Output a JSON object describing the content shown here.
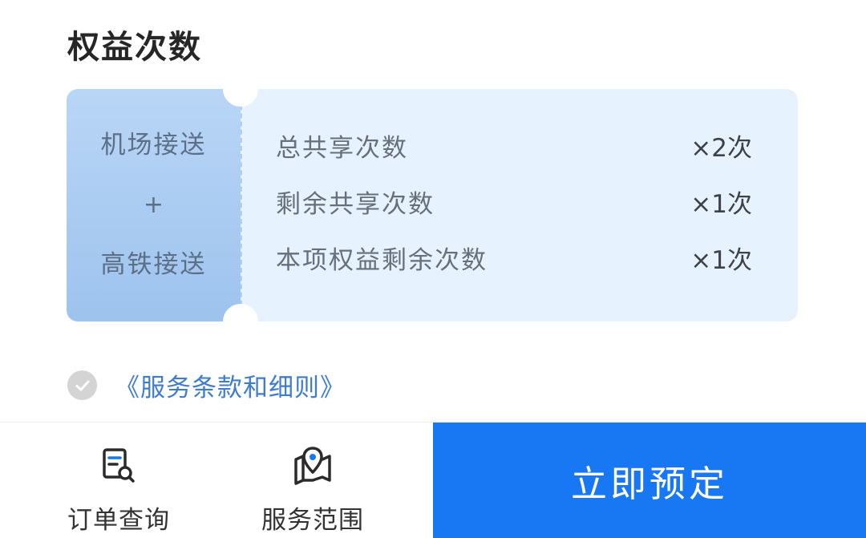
{
  "section": {
    "title": "权益次数"
  },
  "ticket": {
    "services": [
      "机场接送",
      "+",
      "高铁接送"
    ],
    "rows": [
      {
        "label": "总共享次数",
        "count": "×2次"
      },
      {
        "label": "剩余共享次数",
        "count": "×1次"
      },
      {
        "label": "本项权益剩余次数",
        "count": "×1次"
      }
    ]
  },
  "terms": {
    "link_text": "《服务条款和细则》",
    "checked": false
  },
  "bottom_bar": {
    "order_query_label": "订单查询",
    "service_area_label": "服务范围",
    "book_now_label": "立即预定"
  },
  "colors": {
    "accent": "#1877f2",
    "ticket_left": "#a9ccf2",
    "ticket_right": "#e6f2fd",
    "link": "#3d7cd0"
  }
}
